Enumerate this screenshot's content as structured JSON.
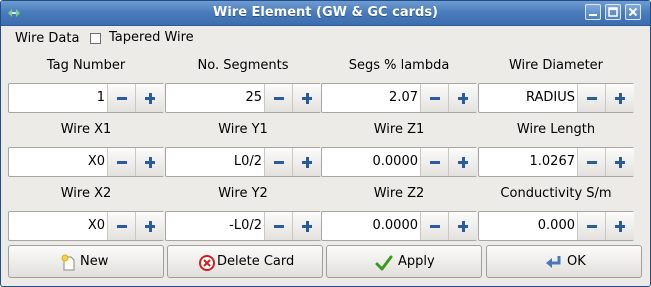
{
  "window": {
    "title": "Wire Element (GW & GC cards)",
    "buttons": [
      "minimize-icon",
      "maximize-icon",
      "close-icon"
    ]
  },
  "wire_data": {
    "label": "Wire Data",
    "tapered_checked": false,
    "tapered_label": "Tapered Wire"
  },
  "row1": {
    "tag_number": {
      "label": "Tag Number",
      "value": "1"
    },
    "segments": {
      "label": "No. Segments",
      "value": "25"
    },
    "segs_lambda": {
      "label": "Segs % lambda",
      "value": "2.07"
    },
    "diameter": {
      "label": "Wire Diameter",
      "value": "RADIUS"
    }
  },
  "row2": {
    "x1": {
      "label": "Wire X1",
      "value": "X0"
    },
    "y1": {
      "label": "Wire Y1",
      "value": "L0/2"
    },
    "z1": {
      "label": "Wire Z1",
      "value": "0.0000"
    },
    "length": {
      "label": "Wire Length",
      "value": "1.0267"
    }
  },
  "row3": {
    "x2": {
      "label": "Wire X2",
      "value": "X0"
    },
    "y2": {
      "label": "Wire Y2",
      "value": "-L0/2"
    },
    "z2": {
      "label": "Wire Z2",
      "value": "0.0000"
    },
    "conductivity": {
      "label": "Conductivity S/m",
      "value": "0.000"
    }
  },
  "buttons": {
    "new": {
      "label": "New",
      "icon": "new-card-icon"
    },
    "delete": {
      "label": "Delete Card",
      "icon": "delete-icon"
    },
    "apply": {
      "label": "Apply",
      "icon": "checkmark-icon"
    },
    "ok": {
      "label": "OK",
      "icon": "enter-arrow-icon"
    }
  },
  "colors": {
    "titlebar": "#4b7dbd",
    "spin_icon": "#2a5b9e",
    "window_bg": "#ecebe8"
  }
}
